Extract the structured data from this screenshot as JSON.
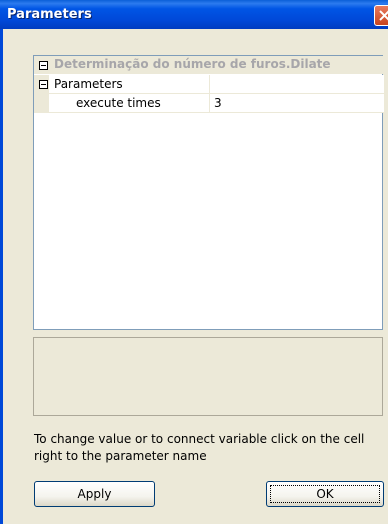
{
  "window": {
    "title": "Parameters"
  },
  "grid": {
    "category": "Determinação do número de furos.Dilate",
    "group": "Parameters",
    "properties": [
      {
        "name": "execute times",
        "value": "3"
      }
    ]
  },
  "hint": "To change value or to connect variable click on the cell right to the parameter name",
  "buttons": {
    "apply": "Apply",
    "ok": "OK"
  }
}
